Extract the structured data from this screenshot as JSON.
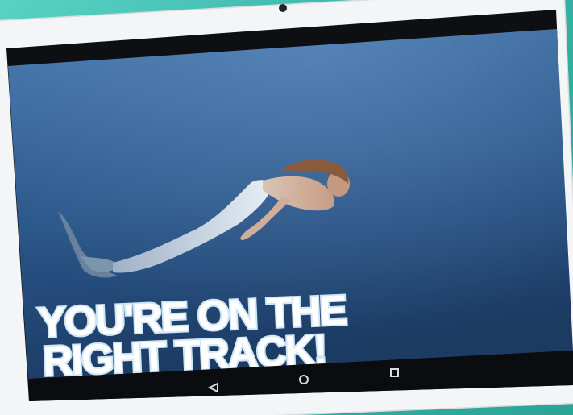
{
  "device": {
    "type": "tablet"
  },
  "video": {
    "scene": "underwater",
    "colors": {
      "water_top": "#3b6aa0",
      "water_bottom": "#1f3b63",
      "accent_light": "#5a86b6"
    }
  },
  "caption": {
    "line1": "YOU'RE ON THE",
    "line2": "RIGHT TRACK!"
  },
  "navigation_bar": {
    "back_icon": "back-triangle-icon",
    "home_icon": "home-circle-icon",
    "recents_icon": "recents-square-icon"
  }
}
